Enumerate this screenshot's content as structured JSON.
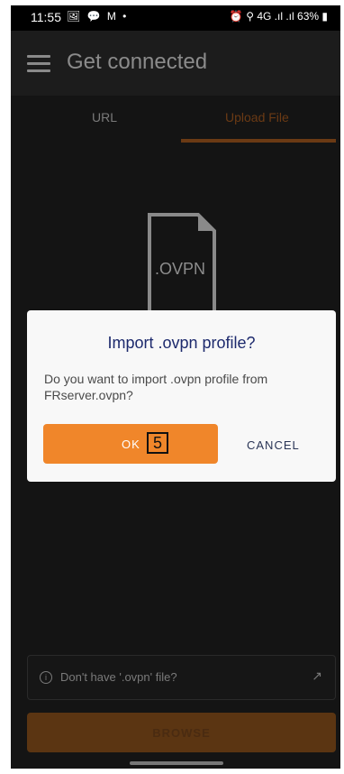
{
  "status": {
    "time": "11:55",
    "left_icons": "🖼 💬 M •",
    "battery": "63%",
    "right_icons": "⏰ ⚲ 4G .ıl .ıl"
  },
  "appbar": {
    "title": "Get connected"
  },
  "tabs": [
    {
      "label": "URL"
    },
    {
      "label": "Upload File"
    }
  ],
  "file_icon": {
    "label": ".OVPN"
  },
  "dialog": {
    "title": "Import .ovpn profile?",
    "message": "Do you want to import .ovpn profile from FRserver.ovpn?",
    "ok_label": "OK",
    "ok_marker": "5",
    "cancel_label": "CANCEL"
  },
  "hint": {
    "text": "Don't have '.ovpn' file?"
  },
  "browse": {
    "label": "BROWSE"
  },
  "colors": {
    "accent": "#f0862a",
    "dim_accent": "#5b3512",
    "dialog_title": "#1d2a6d"
  }
}
